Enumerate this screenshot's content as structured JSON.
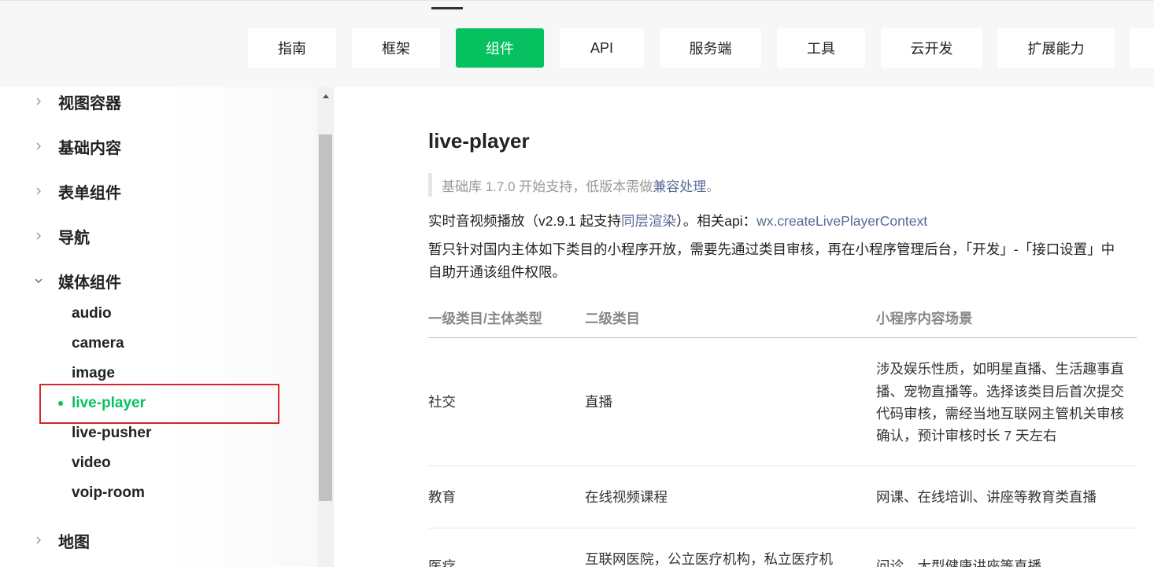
{
  "header": {
    "tabs": [
      {
        "label": "指南"
      },
      {
        "label": "框架"
      },
      {
        "label": "组件"
      },
      {
        "label": "API"
      },
      {
        "label": "服务端"
      },
      {
        "label": "工具"
      },
      {
        "label": "云开发"
      },
      {
        "label": "扩展能力"
      }
    ],
    "active_tab": "组件",
    "accent_color": "#07c160"
  },
  "sidebar": {
    "categories": [
      {
        "label": "视图容器",
        "icon": "chevron-right-icon"
      },
      {
        "label": "基础内容",
        "icon": "chevron-right-icon"
      },
      {
        "label": "表单组件",
        "icon": "chevron-right-icon"
      },
      {
        "label": "导航",
        "icon": "chevron-right-icon"
      },
      {
        "label": "媒体组件",
        "icon": "chevron-down-icon"
      },
      {
        "label": "地图",
        "icon": "chevron-right-icon"
      }
    ],
    "media_items": [
      {
        "label": "audio"
      },
      {
        "label": "camera"
      },
      {
        "label": "image"
      },
      {
        "label": "live-player"
      },
      {
        "label": "live-pusher"
      },
      {
        "label": "video"
      },
      {
        "label": "voip-room"
      }
    ],
    "active_item": "live-player",
    "highlight_color": "#d8262a"
  },
  "content": {
    "title": "live-player",
    "note_prefix": "基础库 1.7.0 开始支持，低版本需做",
    "note_link": "兼容处理",
    "note_suffix": "。",
    "line1_prefix": "实时音视频播放（v2.9.1 起支持",
    "line1_link": "同层渲染",
    "line1_mid": "）。相关api：",
    "line1_api_link": "wx.createLivePlayerContext",
    "line2": "暂只针对国内主体如下类目的小程序开放，需要先通过类目审核，再在小程序管理后台，「开发」-「接口设置」中",
    "line3": "自助开通该组件权限。",
    "link_color": "#576b95"
  },
  "table": {
    "headers": [
      "一级类目/主体类型",
      "二级类目",
      "小程序内容场景"
    ],
    "rows": [
      {
        "c1": "社交",
        "c2": "直播",
        "c3": [
          "涉及娱乐性质，如明星直播、生活趣事直",
          "播、宠物直播等。选择该类目后首次提交",
          "代码审核，需经当地互联网主管机关审核",
          "确认，预计审核时长 7 天左右"
        ]
      },
      {
        "c1": "教育",
        "c2": "在线视频课程",
        "c3": [
          "网课、在线培训、讲座等教育类直播"
        ]
      },
      {
        "c1": "医疗",
        "c2": "互联网医院，公立医疗机构，私立医疗机",
        "c3": [
          "问诊、大型健康讲座等直播"
        ]
      }
    ]
  }
}
